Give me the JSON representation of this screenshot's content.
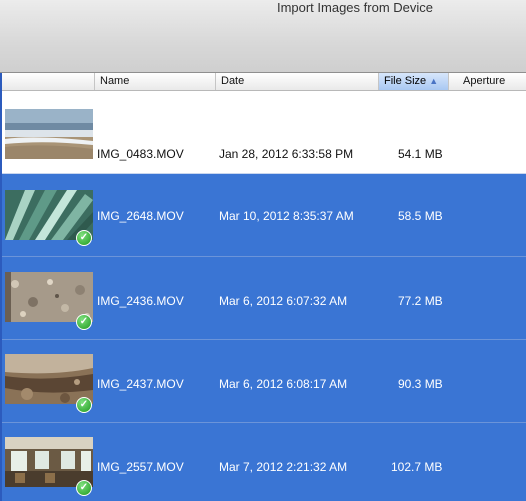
{
  "window": {
    "title": "Import Images from Device"
  },
  "columns": {
    "name": "Name",
    "date": "Date",
    "file_size": "File Size",
    "sort_icon": "sort-ascending-arrow-icon",
    "aperture": "Aperture"
  },
  "rows": [
    {
      "name": "IMG_0483.MOV",
      "date": "Jan 28, 2012 6:33:58 PM",
      "size": "54.1 MB",
      "selected": false,
      "imported": false,
      "thumbnail": "beach-waves"
    },
    {
      "name": "IMG_2648.MOV",
      "date": "Mar 10, 2012 8:35:37 AM",
      "size": "58.5 MB",
      "selected": true,
      "imported": true,
      "thumbnail": "green-leaves"
    },
    {
      "name": "IMG_2436.MOV",
      "date": "Mar 6, 2012 6:07:32 AM",
      "size": "77.2 MB",
      "selected": true,
      "imported": true,
      "thumbnail": "gravel-ground"
    },
    {
      "name": "IMG_2437.MOV",
      "date": "Mar 6, 2012 6:08:17 AM",
      "size": "90.3 MB",
      "selected": true,
      "imported": true,
      "thumbnail": "rocky-hillside"
    },
    {
      "name": "IMG_2557.MOV",
      "date": "Mar 7, 2012 2:21:32 AM",
      "size": "102.7 MB",
      "selected": true,
      "imported": true,
      "thumbnail": "train-interior"
    }
  ],
  "colors": {
    "selection": "#3a75d4",
    "checkmark": "#2aa62a"
  }
}
